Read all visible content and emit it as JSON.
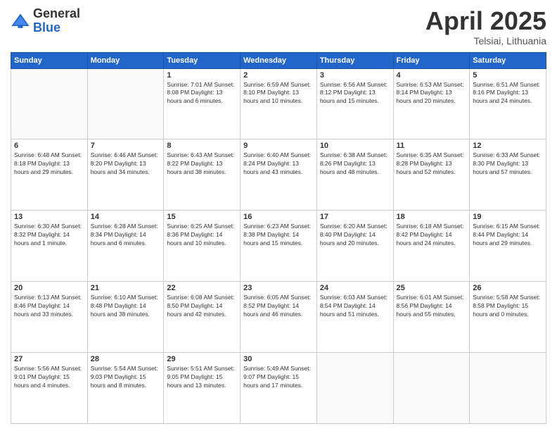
{
  "logo": {
    "general": "General",
    "blue": "Blue"
  },
  "title": {
    "month_year": "April 2025",
    "location": "Telsiai, Lithuania"
  },
  "weekdays": [
    "Sunday",
    "Monday",
    "Tuesday",
    "Wednesday",
    "Thursday",
    "Friday",
    "Saturday"
  ],
  "weeks": [
    [
      {
        "day": "",
        "info": ""
      },
      {
        "day": "",
        "info": ""
      },
      {
        "day": "1",
        "info": "Sunrise: 7:01 AM\nSunset: 8:08 PM\nDaylight: 13 hours and 6 minutes."
      },
      {
        "day": "2",
        "info": "Sunrise: 6:59 AM\nSunset: 8:10 PM\nDaylight: 13 hours and 10 minutes."
      },
      {
        "day": "3",
        "info": "Sunrise: 6:56 AM\nSunset: 8:12 PM\nDaylight: 13 hours and 15 minutes."
      },
      {
        "day": "4",
        "info": "Sunrise: 6:53 AM\nSunset: 8:14 PM\nDaylight: 13 hours and 20 minutes."
      },
      {
        "day": "5",
        "info": "Sunrise: 6:51 AM\nSunset: 8:16 PM\nDaylight: 13 hours and 24 minutes."
      }
    ],
    [
      {
        "day": "6",
        "info": "Sunrise: 6:48 AM\nSunset: 8:18 PM\nDaylight: 13 hours and 29 minutes."
      },
      {
        "day": "7",
        "info": "Sunrise: 6:46 AM\nSunset: 8:20 PM\nDaylight: 13 hours and 34 minutes."
      },
      {
        "day": "8",
        "info": "Sunrise: 6:43 AM\nSunset: 8:22 PM\nDaylight: 13 hours and 38 minutes."
      },
      {
        "day": "9",
        "info": "Sunrise: 6:40 AM\nSunset: 8:24 PM\nDaylight: 13 hours and 43 minutes."
      },
      {
        "day": "10",
        "info": "Sunrise: 6:38 AM\nSunset: 8:26 PM\nDaylight: 13 hours and 48 minutes."
      },
      {
        "day": "11",
        "info": "Sunrise: 6:35 AM\nSunset: 8:28 PM\nDaylight: 13 hours and 52 minutes."
      },
      {
        "day": "12",
        "info": "Sunrise: 6:33 AM\nSunset: 8:30 PM\nDaylight: 13 hours and 57 minutes."
      }
    ],
    [
      {
        "day": "13",
        "info": "Sunrise: 6:30 AM\nSunset: 8:32 PM\nDaylight: 14 hours and 1 minute."
      },
      {
        "day": "14",
        "info": "Sunrise: 6:28 AM\nSunset: 8:34 PM\nDaylight: 14 hours and 6 minutes."
      },
      {
        "day": "15",
        "info": "Sunrise: 6:25 AM\nSunset: 8:36 PM\nDaylight: 14 hours and 10 minutes."
      },
      {
        "day": "16",
        "info": "Sunrise: 6:23 AM\nSunset: 8:38 PM\nDaylight: 14 hours and 15 minutes."
      },
      {
        "day": "17",
        "info": "Sunrise: 6:20 AM\nSunset: 8:40 PM\nDaylight: 14 hours and 20 minutes."
      },
      {
        "day": "18",
        "info": "Sunrise: 6:18 AM\nSunset: 8:42 PM\nDaylight: 14 hours and 24 minutes."
      },
      {
        "day": "19",
        "info": "Sunrise: 6:15 AM\nSunset: 8:44 PM\nDaylight: 14 hours and 29 minutes."
      }
    ],
    [
      {
        "day": "20",
        "info": "Sunrise: 6:13 AM\nSunset: 8:46 PM\nDaylight: 14 hours and 33 minutes."
      },
      {
        "day": "21",
        "info": "Sunrise: 6:10 AM\nSunset: 8:48 PM\nDaylight: 14 hours and 38 minutes."
      },
      {
        "day": "22",
        "info": "Sunrise: 6:08 AM\nSunset: 8:50 PM\nDaylight: 14 hours and 42 minutes."
      },
      {
        "day": "23",
        "info": "Sunrise: 6:05 AM\nSunset: 8:52 PM\nDaylight: 14 hours and 46 minutes."
      },
      {
        "day": "24",
        "info": "Sunrise: 6:03 AM\nSunset: 8:54 PM\nDaylight: 14 hours and 51 minutes."
      },
      {
        "day": "25",
        "info": "Sunrise: 6:01 AM\nSunset: 8:56 PM\nDaylight: 14 hours and 55 minutes."
      },
      {
        "day": "26",
        "info": "Sunrise: 5:58 AM\nSunset: 8:58 PM\nDaylight: 15 hours and 0 minutes."
      }
    ],
    [
      {
        "day": "27",
        "info": "Sunrise: 5:56 AM\nSunset: 9:01 PM\nDaylight: 15 hours and 4 minutes."
      },
      {
        "day": "28",
        "info": "Sunrise: 5:54 AM\nSunset: 9:03 PM\nDaylight: 15 hours and 8 minutes."
      },
      {
        "day": "29",
        "info": "Sunrise: 5:51 AM\nSunset: 9:05 PM\nDaylight: 15 hours and 13 minutes."
      },
      {
        "day": "30",
        "info": "Sunrise: 5:49 AM\nSunset: 9:07 PM\nDaylight: 15 hours and 17 minutes."
      },
      {
        "day": "",
        "info": ""
      },
      {
        "day": "",
        "info": ""
      },
      {
        "day": "",
        "info": ""
      }
    ]
  ]
}
